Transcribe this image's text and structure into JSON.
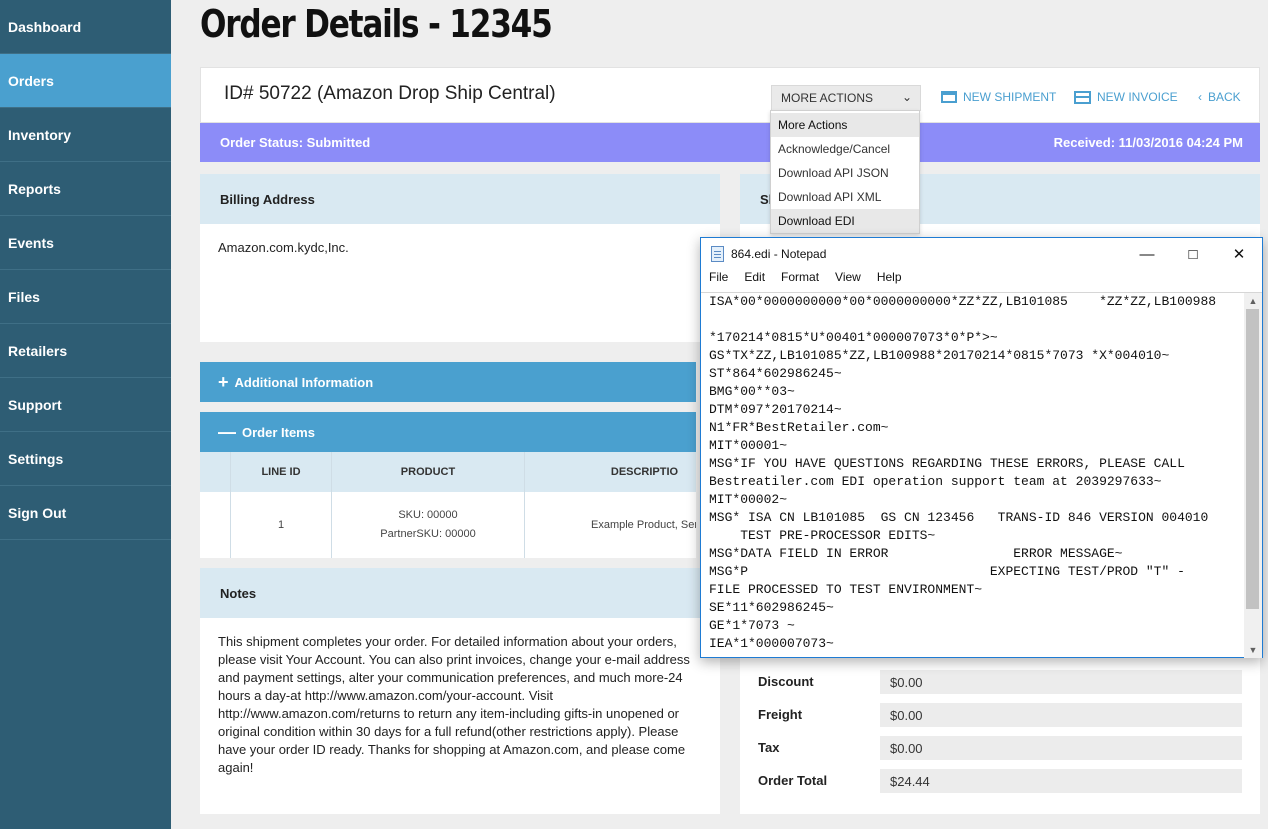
{
  "sidebar": {
    "items": [
      {
        "label": "Dashboard"
      },
      {
        "label": "Orders"
      },
      {
        "label": "Inventory"
      },
      {
        "label": "Reports"
      },
      {
        "label": "Events"
      },
      {
        "label": "Files"
      },
      {
        "label": "Retailers"
      },
      {
        "label": "Support"
      },
      {
        "label": "Settings"
      },
      {
        "label": "Sign Out"
      }
    ],
    "active": "Orders",
    "bg_color": "#2e5d74",
    "active_color": "#4aa0cf"
  },
  "page": {
    "title": "Order Details - 12345"
  },
  "header": {
    "order_id": "ID# 50722 (Amazon Drop Ship Central)",
    "more_actions_label": "MORE ACTIONS",
    "new_shipment_label": "NEW SHIPMENT",
    "new_invoice_label": "NEW INVOICE",
    "back_label": "BACK"
  },
  "status": {
    "left": "Order Status: Submitted",
    "right": "Received: 11/03/2016 04:24 PM",
    "color": "#8c8cf8"
  },
  "dropdown": {
    "options": [
      "More Actions",
      "Acknowledge/Cancel",
      "Download API JSON",
      "Download API XML",
      "Download EDI"
    ]
  },
  "billing": {
    "heading": "Billing Address",
    "text": "Amazon.com.kydc,Inc."
  },
  "shipping": {
    "heading_partial": "Sl"
  },
  "additional_info": {
    "label": "Additional Information"
  },
  "order_items": {
    "label": "Order Items",
    "columns": [
      "LINE ID",
      "PRODUCT",
      "DESCRIPTIO"
    ],
    "rows": [
      {
        "line_id": "1",
        "sku": "SKU: 00000",
        "partner_sku": "PartnerSKU: 00000",
        "description": "Example Product, Ser"
      }
    ]
  },
  "notes": {
    "heading": "Notes",
    "text": "This shipment completes your order. For detailed information about your orders, please visit Your Account. You can also print invoices, change your e-mail address and payment settings, alter your communication preferences, and much more-24 hours a day-at http://www.amazon.com/your-account. Visit http://www.amazon.com/returns to return any item-including gifts-in unopened or original condition within 30 days for a full refund(other restrictions apply). Please have your order ID ready. Thanks for shopping at Amazon.com, and please come again!"
  },
  "totals": {
    "rows": [
      {
        "label": "Discount",
        "value": "$0.00"
      },
      {
        "label": "Freight",
        "value": "$0.00"
      },
      {
        "label": "Tax",
        "value": "$0.00"
      },
      {
        "label": "Order Total",
        "value": "$24.44"
      }
    ]
  },
  "notepad": {
    "title": "864.edi - Notepad",
    "menu": [
      "File",
      "Edit",
      "Format",
      "View",
      "Help"
    ],
    "lines": [
      "ISA*00*0000000000*00*0000000000*ZZ*ZZ,LB101085    *ZZ*ZZ,LB100988",
      "",
      "*170214*0815*U*00401*000007073*0*P*>~",
      "GS*TX*ZZ,LB101085*ZZ,LB100988*20170214*0815*7073 *X*004010~",
      "ST*864*602986245~",
      "BMG*00**03~",
      "DTM*097*20170214~",
      "N1*FR*BestRetailer.com~",
      "MIT*00001~",
      "MSG*IF YOU HAVE QUESTIONS REGARDING THESE ERRORS, PLEASE CALL",
      "Bestreatiler.com EDI operation support team at 2039297633~",
      "MIT*00002~",
      "MSG* ISA CN LB101085  GS CN 123456   TRANS-ID 846 VERSION 004010",
      "    TEST PRE-PROCESSOR EDITS~",
      "MSG*DATA FIELD IN ERROR                ERROR MESSAGE~",
      "MSG*P                               EXPECTING TEST/PROD \"T\" -",
      "FILE PROCESSED TO TEST ENVIRONMENT~",
      "SE*11*602986245~",
      "GE*1*7073 ~",
      "IEA*1*000007073~"
    ]
  }
}
